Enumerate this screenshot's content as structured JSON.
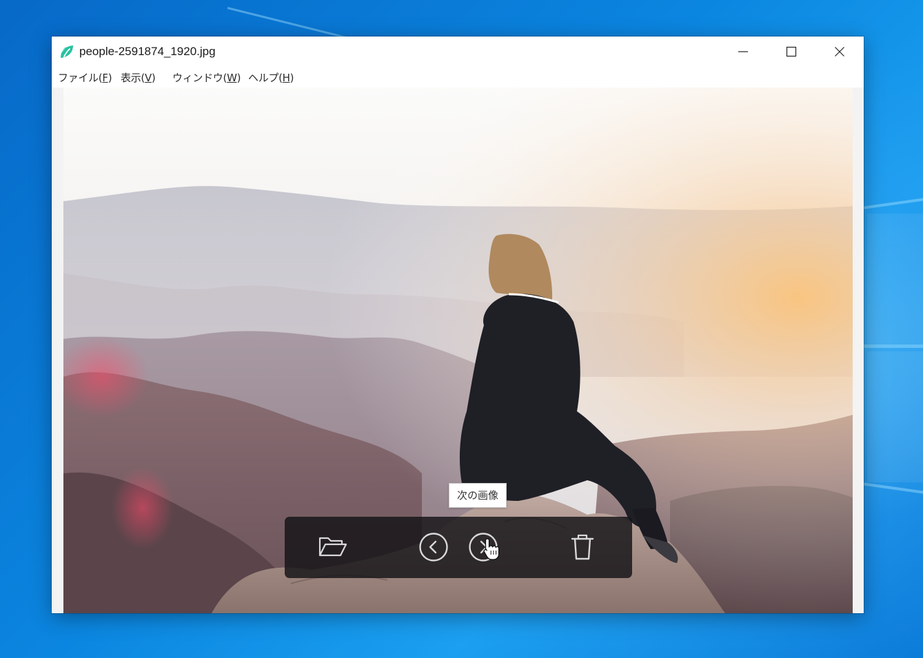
{
  "window": {
    "title": "people-2591874_1920.jpg",
    "app_icon": "leaf-icon",
    "controls": {
      "minimize_icon": "minimize-icon",
      "maximize_icon": "maximize-icon",
      "close_icon": "close-icon"
    }
  },
  "menubar": {
    "items": [
      {
        "label": "ファイル(",
        "key": "F",
        "suffix": ")"
      },
      {
        "label": "表示(",
        "key": "V",
        "suffix": ")"
      },
      {
        "label": "ウィンドウ(",
        "key": "W",
        "suffix": ")"
      },
      {
        "label": "ヘルプ(",
        "key": "H",
        "suffix": ")"
      }
    ]
  },
  "toolbar": {
    "open_icon": "folder-open-icon",
    "prev_icon": "chevron-left-circle-icon",
    "next_icon": "chevron-right-circle-icon",
    "delete_icon": "trash-icon"
  },
  "tooltip": {
    "text": "次の画像"
  },
  "colors": {
    "accent_leaf": "#27c2a0",
    "toolbar_bg": "#141216",
    "desktop": "#0a78d7"
  }
}
